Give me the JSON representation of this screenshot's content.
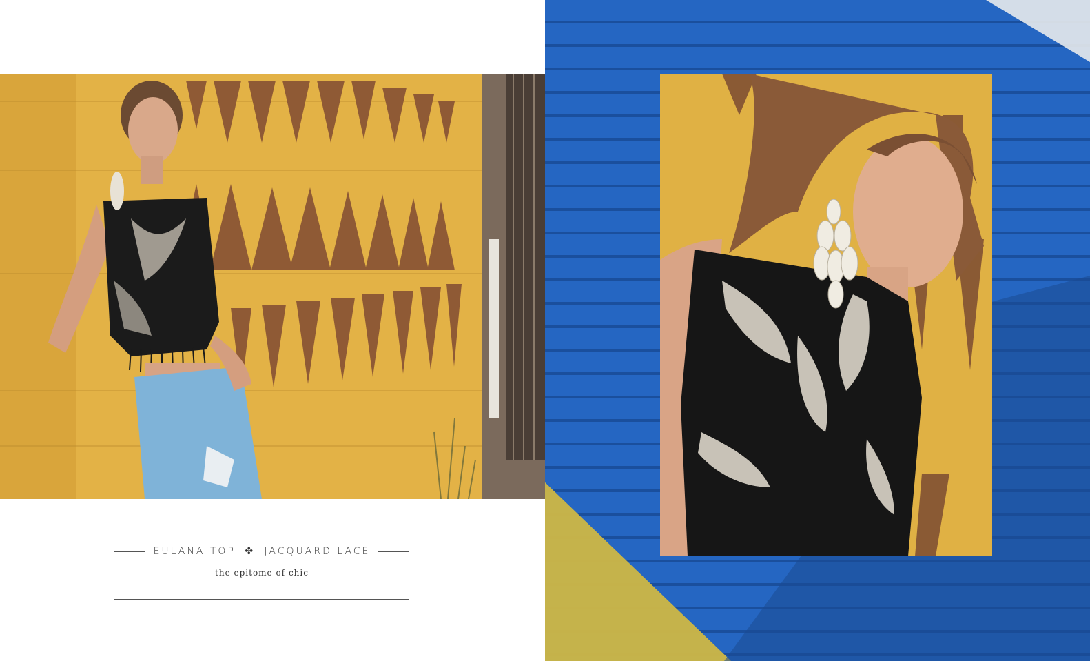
{
  "caption": {
    "product": "EULANA TOP",
    "ornament": "✤",
    "fabric": "JACQUARD LACE",
    "tagline": "the epitome of chic"
  },
  "colors": {
    "wall_yellow": "#e2b347",
    "door_blue": "#2566c2",
    "paint_olive": "#c9b64a",
    "rule_gray": "#555555"
  }
}
